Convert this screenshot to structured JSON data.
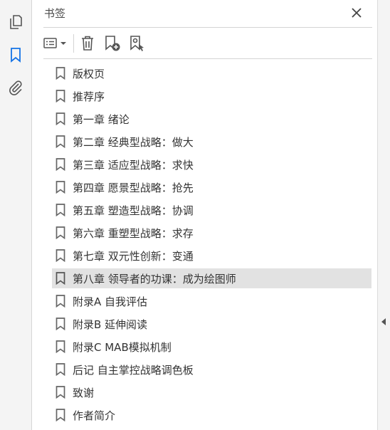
{
  "panel": {
    "title": "书签"
  },
  "toolstrip": {
    "icons": [
      "pages-icon",
      "bookmark-icon",
      "attachment-icon"
    ],
    "active": "bookmark-icon",
    "active_color": "#1473e6"
  },
  "toolbar": {
    "icons": [
      "options-menu-icon",
      "delete-icon",
      "new-bookmark-icon",
      "bookmark-settings-icon"
    ]
  },
  "bookmarks": {
    "selected_index": 9,
    "items": [
      {
        "label": "版权页"
      },
      {
        "label": "推荐序"
      },
      {
        "label": "第一章 绪论"
      },
      {
        "label": "第二章 经典型战略：做大"
      },
      {
        "label": "第三章 适应型战略：求快"
      },
      {
        "label": "第四章 愿景型战略：抢先"
      },
      {
        "label": "第五章 塑造型战略：协调"
      },
      {
        "label": "第六章 重塑型战略：求存"
      },
      {
        "label": "第七章 双元性创新：变通"
      },
      {
        "label": "第八章 领导者的功课：成为绘图师"
      },
      {
        "label": "附录A 自我评估"
      },
      {
        "label": "附录B 延伸阅读"
      },
      {
        "label": "附录C MAB模拟机制"
      },
      {
        "label": "后记 自主掌控战略调色板"
      },
      {
        "label": "致谢"
      },
      {
        "label": "作者简介"
      }
    ]
  }
}
